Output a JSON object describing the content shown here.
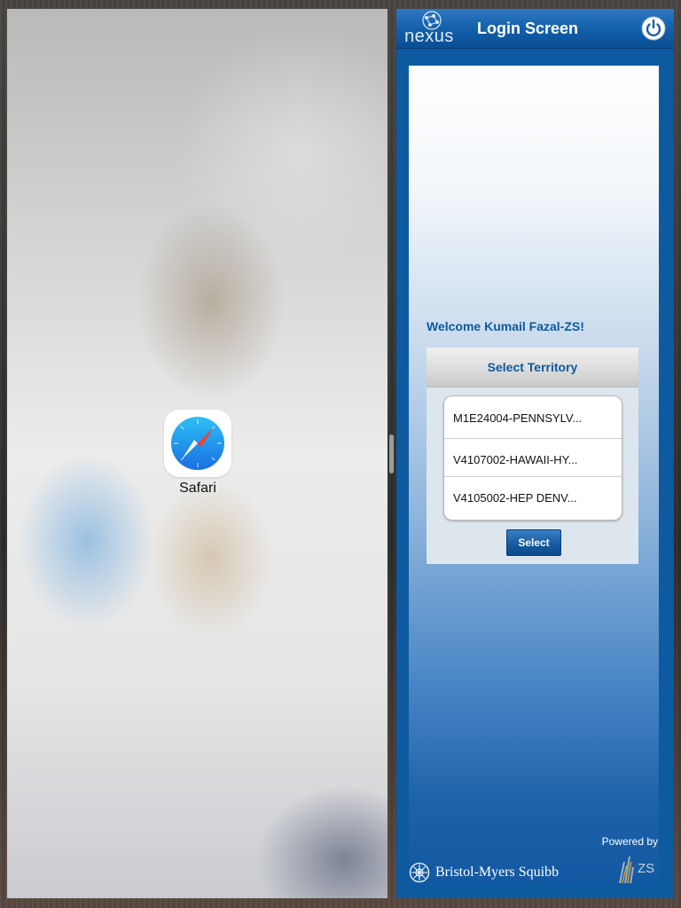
{
  "left_pane": {
    "app_label": "Safari",
    "app_icon": "safari-compass-icon"
  },
  "header": {
    "logo_text": "nexus",
    "title": "Login Screen",
    "power_icon": "power-icon"
  },
  "welcome": "Welcome Kumail Fazal-ZS!",
  "territory": {
    "header": "Select Territory",
    "items": [
      "M1E24004-PENNSYLV...",
      "V4107002-HAWAII-HY...",
      "V4105002-HEP DENV..."
    ],
    "select_label": "Select"
  },
  "footer": {
    "powered_by": "Powered by",
    "bms_name": "Bristol-Myers Squibb",
    "zs_name": "ZS"
  },
  "colors": {
    "accent": "#0d5aa0",
    "header_blue": "#125ea8",
    "white": "#ffffff"
  }
}
